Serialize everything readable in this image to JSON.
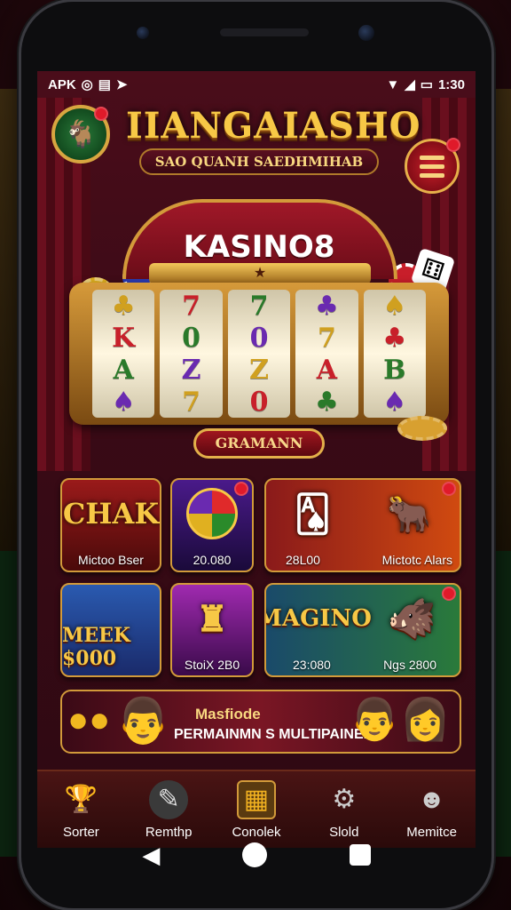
{
  "status": {
    "carrier": "APK",
    "time": "1:30"
  },
  "header": {
    "title": "IIANGAIASHO",
    "subtitle": "SAO QUANH SAEDHMIHAB"
  },
  "slot": {
    "title": "KASINO8",
    "band": "★",
    "reels": [
      [
        "♣",
        "K",
        "A",
        "♠"
      ],
      [
        "7",
        "0",
        "Z",
        "7"
      ],
      [
        "7",
        "0",
        "Z",
        "0"
      ],
      [
        "♣",
        "7",
        "A",
        "♣"
      ],
      [
        "♠",
        "♣",
        "B",
        "♠"
      ]
    ],
    "button": "GRAMANN"
  },
  "games": [
    {
      "art": "CHAK",
      "label": "Mictoo Bser"
    },
    {
      "art": "",
      "label": "20.080"
    },
    {
      "art": "",
      "label": "28L00"
    },
    {
      "art": "",
      "label": "Mictotc Alars"
    },
    {
      "art": "MEEK $000",
      "label": ""
    },
    {
      "art": "",
      "label": "StoiX 2B0"
    },
    {
      "art": "MAGINO",
      "label": "23:080"
    },
    {
      "art": "",
      "label": "Ngs 2800"
    }
  ],
  "banner": {
    "title": "Masfiode",
    "subtitle": "PERMAINMN S MULTIPAINEN"
  },
  "nav": [
    {
      "icon": "trophy-icon",
      "label": "Sorter"
    },
    {
      "icon": "pen-icon",
      "label": "Remthp"
    },
    {
      "icon": "calendar-icon",
      "label": "Conolek"
    },
    {
      "icon": "gear-icon",
      "label": "Slold"
    },
    {
      "icon": "user-icon",
      "label": "Memitce"
    }
  ],
  "colors": {
    "accent": "#f7c846",
    "brand": "#7a0a14",
    "badge": "#e01a2a"
  }
}
